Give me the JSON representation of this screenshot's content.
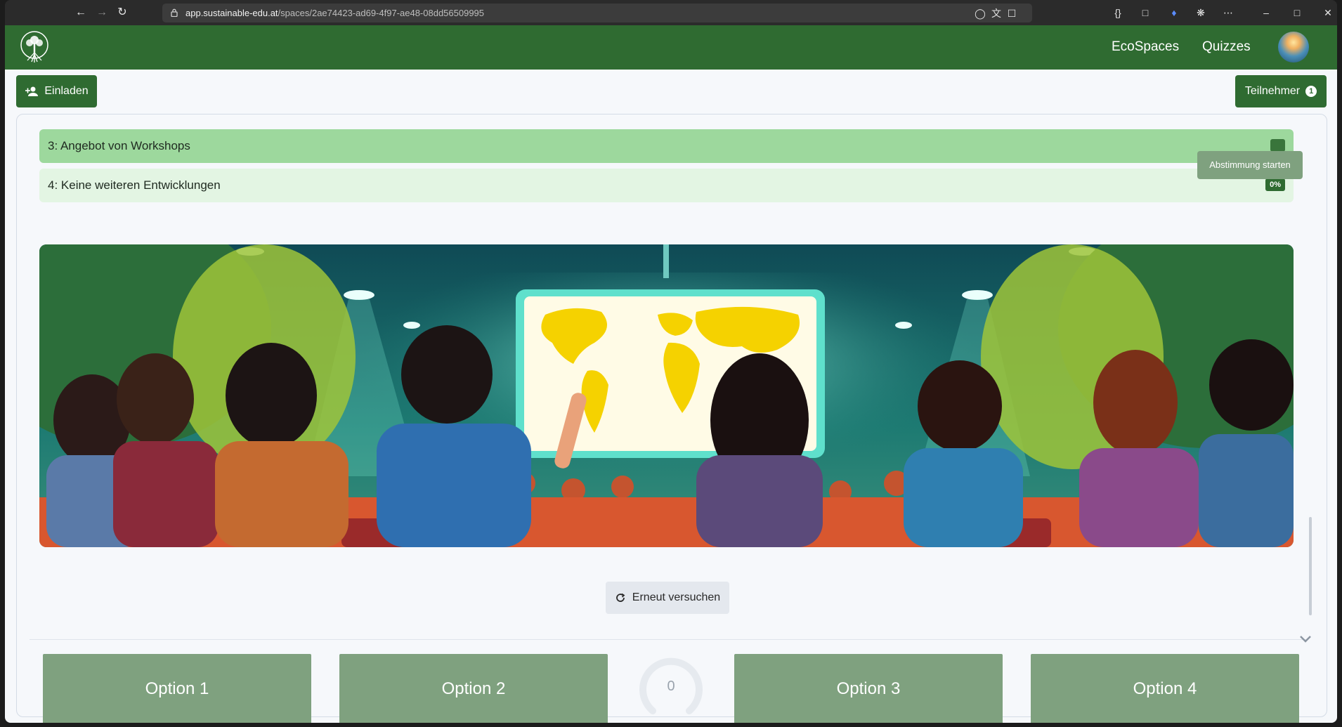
{
  "browser": {
    "url_host": "app.sustainable-edu.at",
    "url_path": "/spaces/2ae74423-ad69-4f97-ae48-08dd56509995"
  },
  "nav": {
    "links": [
      "EcoSpaces",
      "Quizzes"
    ]
  },
  "toolbar": {
    "invite_label": "Einladen",
    "participants_label": "Teilnehmer",
    "participants_count": "1"
  },
  "tooltip": {
    "text": "Abstimmung starten"
  },
  "answers": [
    {
      "label": "3: Angebot von Workshops",
      "percent": ""
    },
    {
      "label": "4: Keine weiteren Entwicklungen",
      "percent": "0%"
    }
  ],
  "retry": {
    "label": "Erneut versuchen"
  },
  "vote_buttons": [
    "Option 1",
    "Option 2",
    "Option 3",
    "Option 4"
  ],
  "counter": {
    "value": "0"
  },
  "colors": {
    "brand_green": "#2f6b31",
    "answer_highlight": "#9dd89d",
    "answer_light": "#e3f5e3",
    "option_button": "#7fa17f"
  }
}
